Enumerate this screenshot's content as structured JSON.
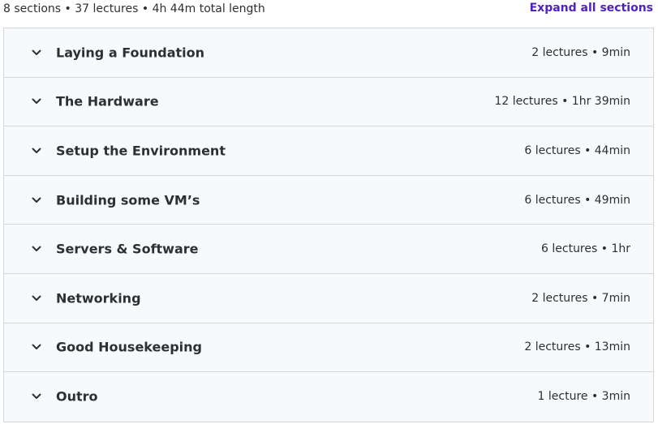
{
  "header": {
    "summary": "8 sections • 37 lectures • 4h 44m total length",
    "expand_label": "Expand all sections"
  },
  "colors": {
    "accent": "#5022c3",
    "row_bg": "#f7f9fa",
    "border": "#d1d7dc",
    "text": "#2d2f31"
  },
  "sections": [
    {
      "title": "Laying a Foundation",
      "meta": "2 lectures • 9min",
      "icon": "chevron-down-icon"
    },
    {
      "title": "The Hardware",
      "meta": "12 lectures • 1hr 39min",
      "icon": "chevron-down-icon"
    },
    {
      "title": "Setup the Environment",
      "meta": "6 lectures • 44min",
      "icon": "chevron-down-icon"
    },
    {
      "title": "Building some VM’s",
      "meta": "6 lectures • 49min",
      "icon": "chevron-down-icon"
    },
    {
      "title": "Servers & Software",
      "meta": "6 lectures • 1hr",
      "icon": "chevron-down-icon"
    },
    {
      "title": "Networking",
      "meta": "2 lectures • 7min",
      "icon": "chevron-down-icon"
    },
    {
      "title": "Good Housekeeping",
      "meta": "2 lectures • 13min",
      "icon": "chevron-down-icon"
    },
    {
      "title": "Outro",
      "meta": "1 lecture • 3min",
      "icon": "chevron-down-icon"
    }
  ]
}
